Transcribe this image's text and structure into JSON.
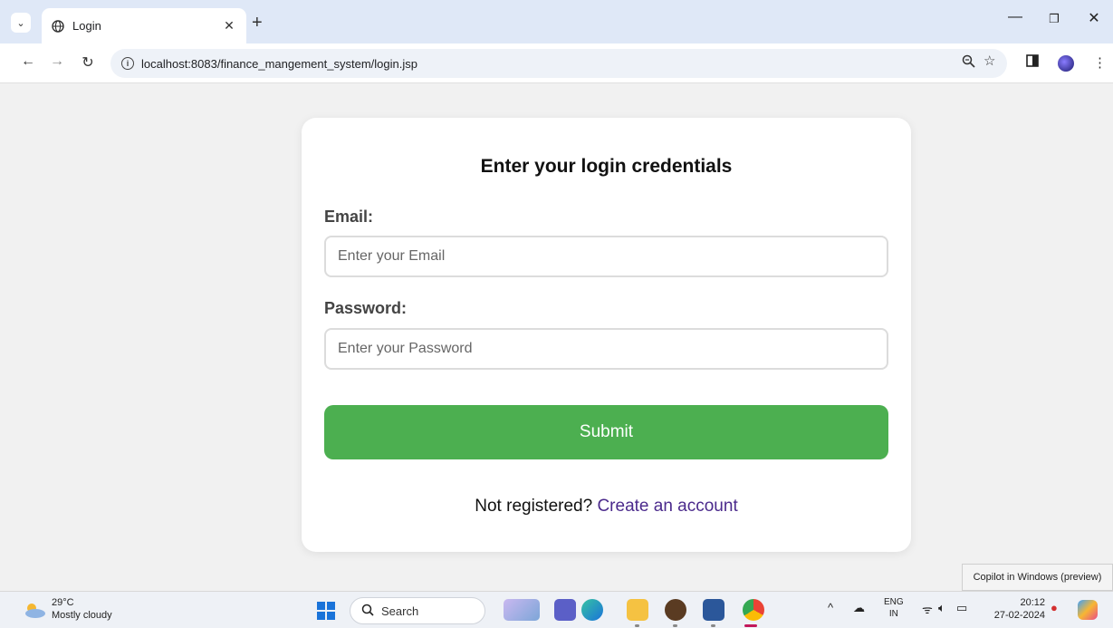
{
  "browser": {
    "tab_title": "Login",
    "url": "localhost:8083/finance_mangement_system/login.jsp"
  },
  "form": {
    "heading": "Enter your login credentials",
    "email_label": "Email:",
    "email_placeholder": "Enter your Email",
    "email_value": "",
    "password_label": "Password:",
    "password_placeholder": "Enter your Password",
    "password_value": "",
    "submit_label": "Submit",
    "register_prompt": "Not registered?",
    "register_link": "Create an account"
  },
  "tooltip": {
    "text": "Copilot in Windows (preview)"
  },
  "taskbar": {
    "weather_temp": "29°C",
    "weather_desc": "Mostly cloudy",
    "search_label": "Search",
    "lang_top": "ENG",
    "lang_bottom": "IN",
    "time": "20:12",
    "date": "27-02-2024"
  },
  "colors": {
    "accent_green": "#4caf50",
    "link_purple": "#4b2a8c",
    "tabbar_bg": "#dfe8f7"
  },
  "icons": [
    "tab-search-icon",
    "globe-icon",
    "close-icon",
    "plus-icon",
    "minimize-icon",
    "restore-icon",
    "back-icon",
    "forward-icon",
    "reload-icon",
    "info-icon",
    "zoom-icon",
    "star-icon",
    "sidepanel-icon",
    "profile-avatar",
    "menu-icon",
    "windows-start-icon",
    "search-icon",
    "chevron-up-icon",
    "wifi-icon",
    "volume-icon",
    "battery-icon",
    "bell-icon",
    "copilot-icon"
  ]
}
